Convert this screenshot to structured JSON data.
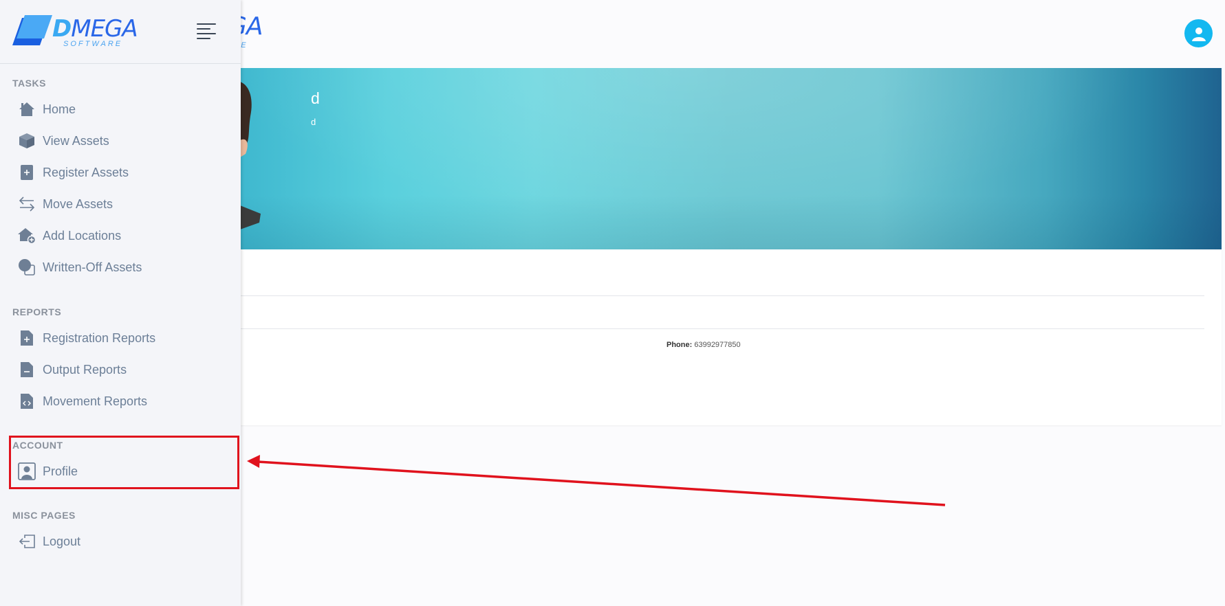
{
  "brand": {
    "logo_letter": "D",
    "logo_rest": "MEGA",
    "logo_sub": "SOFTWARE",
    "behind_logo_text": "GA",
    "behind_logo_sub": "ARE",
    "colors": {
      "primary": "#2a67e8",
      "accent": "#13b8f0"
    }
  },
  "header": {
    "avatar_icon": "user-avatar-icon"
  },
  "profile_banner": {
    "name": "d",
    "subtitle": "d"
  },
  "profile_card": {
    "phone_label": "Phone:",
    "phone_value": "63992977850"
  },
  "sidebar": {
    "sections": [
      {
        "title": "TASKS",
        "items": [
          {
            "label": "Home",
            "icon": "home-icon"
          },
          {
            "label": "View Assets",
            "icon": "box-icon"
          },
          {
            "label": "Register Assets",
            "icon": "file-plus-icon"
          },
          {
            "label": "Move Assets",
            "icon": "arrows-swap-icon"
          },
          {
            "label": "Add Locations",
            "icon": "house-plus-icon"
          },
          {
            "label": "Written-Off Assets",
            "icon": "written-off-icon"
          }
        ]
      },
      {
        "title": "REPORTS",
        "items": [
          {
            "label": "Registration Reports",
            "icon": "file-plus-icon"
          },
          {
            "label": "Output Reports",
            "icon": "file-minus-icon"
          },
          {
            "label": "Movement Reports",
            "icon": "file-code-icon"
          }
        ]
      },
      {
        "title": "ACCOUNT",
        "items": [
          {
            "label": "Profile",
            "icon": "profile-icon"
          }
        ]
      },
      {
        "title": "MISC PAGES",
        "items": [
          {
            "label": "Logout",
            "icon": "logout-icon"
          }
        ]
      }
    ]
  },
  "annotation": {
    "highlight_color": "#e0121d"
  }
}
